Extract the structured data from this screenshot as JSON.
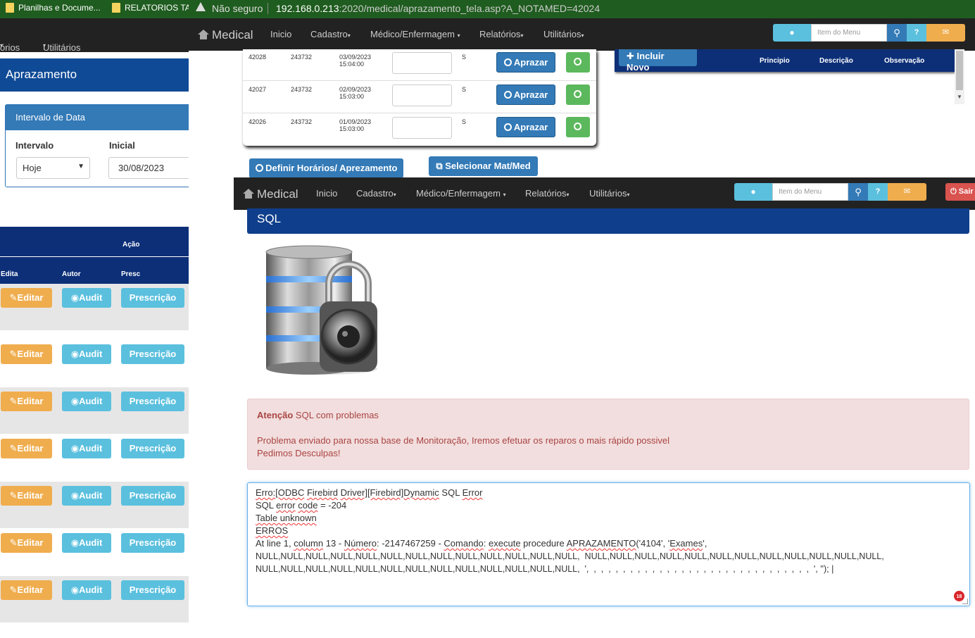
{
  "left_window": {
    "bookmarks": [
      "Planilhas e Docume...",
      "RELATORIOS TAS"
    ],
    "nav": [
      "órios",
      "Utilitários"
    ],
    "title": "Aprazamento",
    "panel": {
      "title": "Intervalo de Data",
      "intervalo_label": "Intervalo",
      "intervalo_value": "Hoje",
      "inicial_label": "Inicial",
      "inicial_value": "30/08/2023"
    },
    "table_headers": {
      "group": "Ação",
      "cols": [
        "Edita",
        "Autor",
        "Presc"
      ]
    },
    "row_buttons": {
      "edit": "Editar",
      "audit": "Audit",
      "presc": "Prescrição"
    }
  },
  "browser": {
    "security": "Não seguro",
    "url_host": "192.168.0.213",
    "url_rest": ":2020/medical/aprazamento_tela.asp?A_NOTAMED=42024"
  },
  "navbar": {
    "brand": "Medical",
    "items": [
      "Inicio",
      "Cadastro",
      "Médico/Enfermagem",
      "Relatórios",
      "Utilitários"
    ],
    "search_placeholder": "Item do Menu",
    "exit": "Sair"
  },
  "aprazamento_rows": [
    {
      "id": "42028",
      "code": "243732",
      "date": "03/09/2023",
      "time": "15:04:00",
      "flag": "S"
    },
    {
      "id": "42027",
      "code": "243732",
      "date": "02/09/2023",
      "time": "15:03:00",
      "flag": "S"
    },
    {
      "id": "42026",
      "code": "243732",
      "date": "01/09/2023",
      "time": "15:03:00",
      "flag": "S"
    }
  ],
  "aprazar_label": "Aprazar",
  "incluir": {
    "label": "Incluir Novo",
    "cols": [
      "Principio",
      "Descrição",
      "Observação"
    ]
  },
  "actions": {
    "definir": "Definir Horários/ Aprezamento",
    "selecionar": "Selecionar Mat/Med"
  },
  "sql_page": {
    "title": "SQL",
    "alert_strong": "Atenção",
    "alert_text": " SQL com problemas",
    "alert_line1": "Problema enviado para nossa base de Monitoração, Iremos efetuar os reparos o mais rápido possivel",
    "alert_line2": "Pedimos Desculpas!",
    "error_lines": {
      "l1a": "Erro:",
      "l1b": "[ODBC",
      "l1c": "Firebird",
      "l1d": "Driver][Firebird]Dynamic",
      "l1e": " SQL ",
      "l1f": "Error",
      "l2a": "SQL ",
      "l2b": "error",
      "l2c": "code",
      "l2d": " = -204",
      "l3": "Table unknown",
      "l4": "ERROS",
      "l5a": "At line 1, ",
      "l5b": "column",
      "l5c": " 13 - ",
      "l5d": "Número",
      "l5e": ": -2147467259 - ",
      "l5f": "Comando",
      "l5g": ": ",
      "l5h": "execute",
      "l5i": " procedure ",
      "l5j": "APRAZAMENTO",
      "l5k": "('4104', '",
      "l5l": "Exames",
      "l5m": "',",
      "l6": "NULL,NULL,NULL,NULL,NULL,NULL,NULL,NULL,NULL,NULL,NULL,NULL,NULL,  NULL,NULL,NULL,NULL,NULL,NULL,NULL,NULL,NULL,NULL,NULL,NULL,",
      "l7": "NULL,NULL,NULL,NULL,NULL,NULL,NULL,NULL,NULL,NULL,NULL,NULL,NULL,  ',  ,  ,  ,  ,  ,  ,  ,  ,  ,  ,  ,  ,  ,  ,  ,  ,  ,  ,  ,  ,  ,  ,  ,  ,  ,  ,  ,  ,  ,  ,  ', ''); |"
    },
    "badge": "18"
  }
}
